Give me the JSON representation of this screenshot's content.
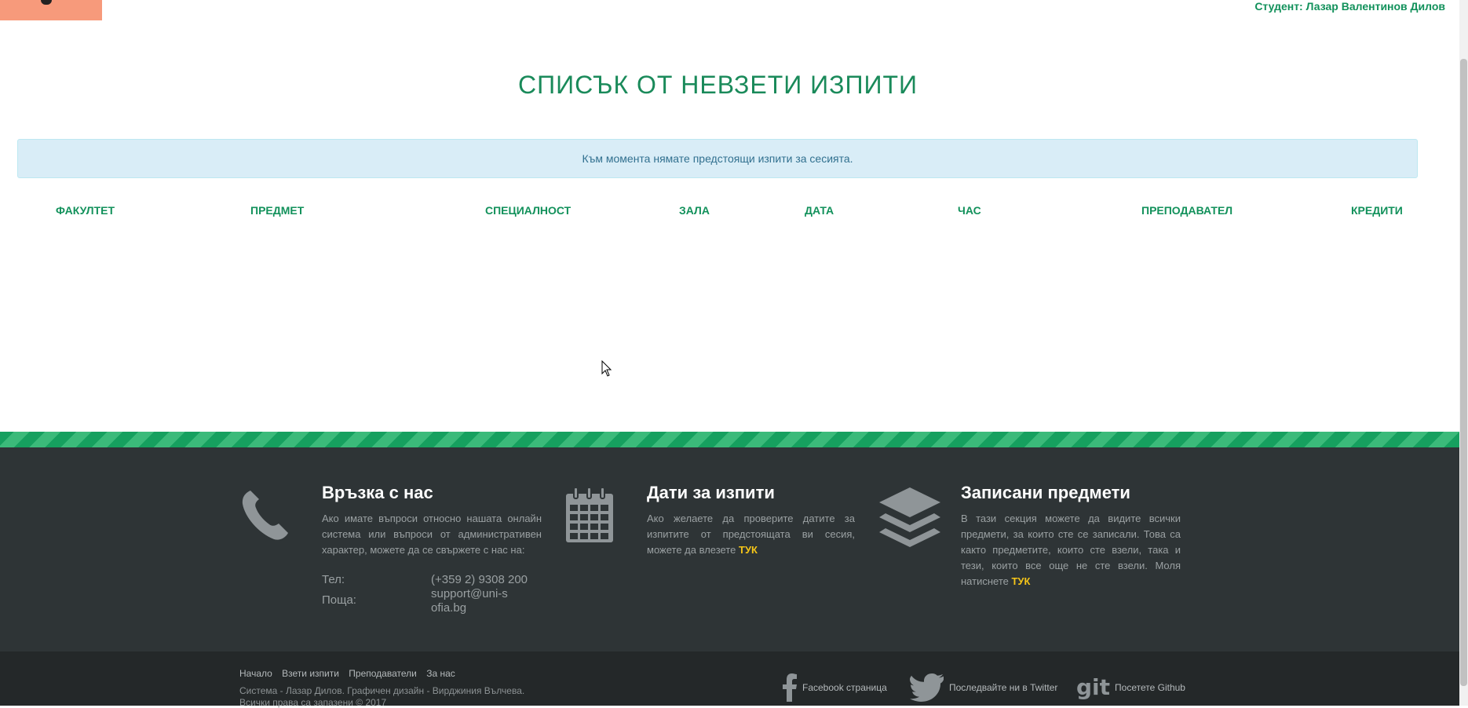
{
  "header": {
    "student": "Студент: Лазар Валентинов Дилов"
  },
  "main": {
    "title": "СПИСЪК ОТ НЕВЗЕТИ ИЗПИТИ",
    "alert": "Към момента нямате предстоящи изпити за сесията.",
    "columns": [
      "ФАКУЛТЕТ",
      "ПРЕДМЕТ",
      "СПЕЦИАЛНОСТ",
      "ЗАЛА",
      "ДАТА",
      "ЧАС",
      "ПРЕПОДАВАТЕЛ",
      "КРЕДИТИ"
    ]
  },
  "footer": {
    "contact": {
      "title": "Връзка с нас",
      "text": "Ако имате въпроси относно нашата онлайн система или въпроси от административен характер, можете да се свържете с нас на:",
      "phone_label": "Тел:",
      "phone_value": "(+359 2) 9308 200",
      "mail_label": "Поща:",
      "mail_value": "support@uni-sofia.bg"
    },
    "dates": {
      "title": "Дати за изпити",
      "text": "Ако желаете да проверите датите за изпитите от предстоящата ви сесия, можете да влезете",
      "link": "ТУК"
    },
    "subjects": {
      "title": "Записани предмети",
      "text": "В тази секция можете да видите всички предмети, за които сте се записали. Това са както предметите, които сте взели, така и тези, които все още не сте взели. Моля натиснете",
      "link": "ТУК"
    },
    "nav": [
      "Начало",
      "Взети изпити",
      "Преподаватели",
      "За нас"
    ],
    "copyright_1": "Система - Лазар Дилов. Графичен дизайн - Вирджиния Вълчева.",
    "copyright_2": "Всички права са запазени © 2017",
    "social": {
      "facebook": "Facebook страница",
      "twitter": "Последвайте ни в Twitter",
      "github": "Посетете Github",
      "git_glyph": "git"
    }
  },
  "colors": {
    "accent": "#12915b",
    "footer_bg": "#2e3436",
    "link_highlight": "#f5c518"
  }
}
